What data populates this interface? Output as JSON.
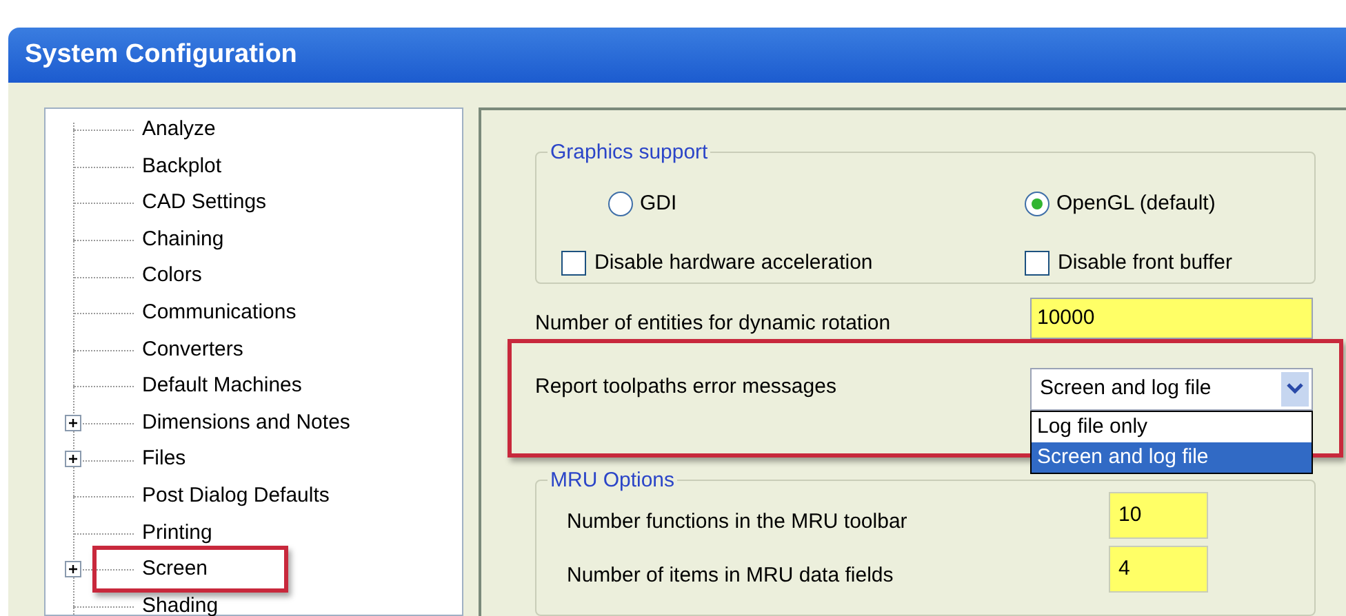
{
  "window": {
    "title": "System Configuration"
  },
  "tree": {
    "items": [
      {
        "label": "Analyze",
        "expandable": false,
        "highlighted": false
      },
      {
        "label": "Backplot",
        "expandable": false,
        "highlighted": false
      },
      {
        "label": "CAD Settings",
        "expandable": false,
        "highlighted": false
      },
      {
        "label": "Chaining",
        "expandable": false,
        "highlighted": false
      },
      {
        "label": "Colors",
        "expandable": false,
        "highlighted": false
      },
      {
        "label": "Communications",
        "expandable": false,
        "highlighted": false
      },
      {
        "label": "Converters",
        "expandable": false,
        "highlighted": false
      },
      {
        "label": "Default Machines",
        "expandable": false,
        "highlighted": false
      },
      {
        "label": "Dimensions and Notes",
        "expandable": true,
        "highlighted": false
      },
      {
        "label": "Files",
        "expandable": true,
        "highlighted": false
      },
      {
        "label": "Post Dialog Defaults",
        "expandable": false,
        "highlighted": false
      },
      {
        "label": "Printing",
        "expandable": false,
        "highlighted": false
      },
      {
        "label": "Screen",
        "expandable": true,
        "highlighted": true
      },
      {
        "label": "Shading",
        "expandable": false,
        "highlighted": false
      }
    ]
  },
  "graphics_support": {
    "title": "Graphics support",
    "radios": [
      {
        "label": "GDI",
        "selected": false
      },
      {
        "label": "OpenGL (default)",
        "selected": true
      }
    ],
    "checkboxes": [
      {
        "label": "Disable hardware acceleration",
        "checked": false
      },
      {
        "label": "Disable front buffer",
        "checked": false
      }
    ]
  },
  "dynamic_rotation": {
    "label": "Number of entities for dynamic rotation",
    "value": "10000"
  },
  "report_errors": {
    "label": "Report toolpaths error messages",
    "value": "Screen and log file",
    "expanded": true,
    "highlighted": true,
    "options": [
      {
        "label": "Log file only",
        "selected": false
      },
      {
        "label": "Screen and log file",
        "selected": true
      }
    ]
  },
  "mru_options": {
    "title": "MRU Options",
    "fields": [
      {
        "label": "Number functions in the MRU toolbar",
        "value": "10"
      },
      {
        "label": "Number of items in MRU data fields",
        "value": "4"
      }
    ]
  }
}
